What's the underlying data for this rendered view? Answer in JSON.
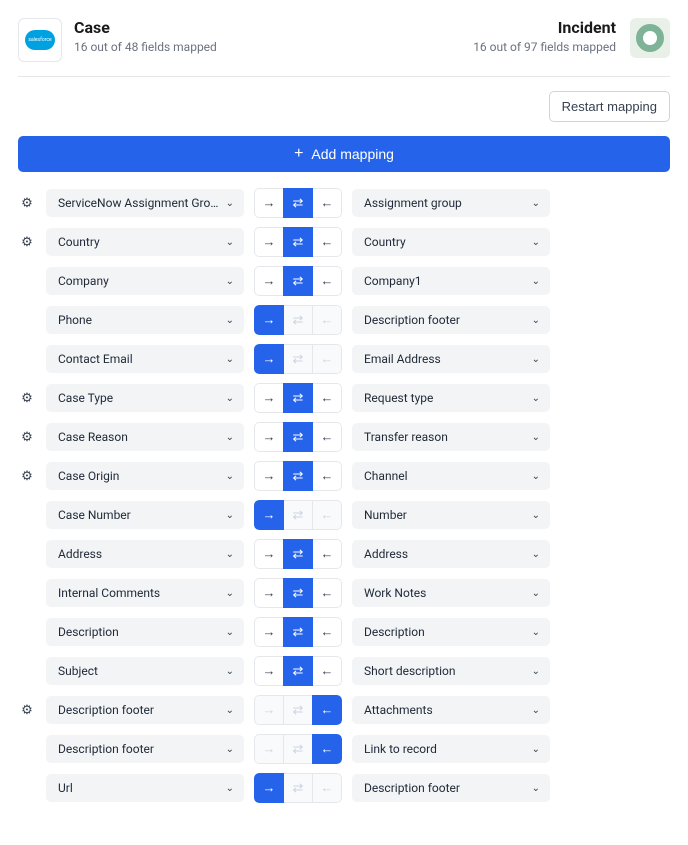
{
  "left": {
    "title": "Case",
    "sub": "16 out of 48 fields mapped"
  },
  "right": {
    "title": "Incident",
    "sub": "16 out of 97 fields mapped"
  },
  "buttons": {
    "restart": "Restart mapping",
    "add": "Add mapping"
  },
  "rows": [
    {
      "gear": true,
      "left": "ServiceNow Assignment Group",
      "right": "Assignment group",
      "dir": "both"
    },
    {
      "gear": true,
      "left": "Country",
      "right": "Country",
      "dir": "both"
    },
    {
      "gear": false,
      "left": "Company",
      "right": "Company1",
      "dir": "both"
    },
    {
      "gear": false,
      "left": "Phone",
      "right": "Description footer",
      "dir": "right"
    },
    {
      "gear": false,
      "left": "Contact Email",
      "right": "Email Address",
      "dir": "right"
    },
    {
      "gear": true,
      "left": "Case Type",
      "right": "Request type",
      "dir": "both"
    },
    {
      "gear": true,
      "left": "Case Reason",
      "right": "Transfer reason",
      "dir": "both"
    },
    {
      "gear": true,
      "left": "Case Origin",
      "right": "Channel",
      "dir": "both"
    },
    {
      "gear": false,
      "left": "Case Number",
      "right": "Number",
      "dir": "right"
    },
    {
      "gear": false,
      "left": "Address",
      "right": "Address",
      "dir": "both"
    },
    {
      "gear": false,
      "left": "Internal Comments",
      "right": "Work Notes",
      "dir": "both"
    },
    {
      "gear": false,
      "left": "Description",
      "right": "Description",
      "dir": "both"
    },
    {
      "gear": false,
      "left": "Subject",
      "right": "Short description",
      "dir": "both"
    },
    {
      "gear": true,
      "left": "Description footer",
      "right": "Attachments",
      "dir": "left"
    },
    {
      "gear": false,
      "left": "Description footer",
      "right": "Link to record",
      "dir": "left"
    },
    {
      "gear": false,
      "left": "Url",
      "right": "Description footer",
      "dir": "right"
    }
  ]
}
